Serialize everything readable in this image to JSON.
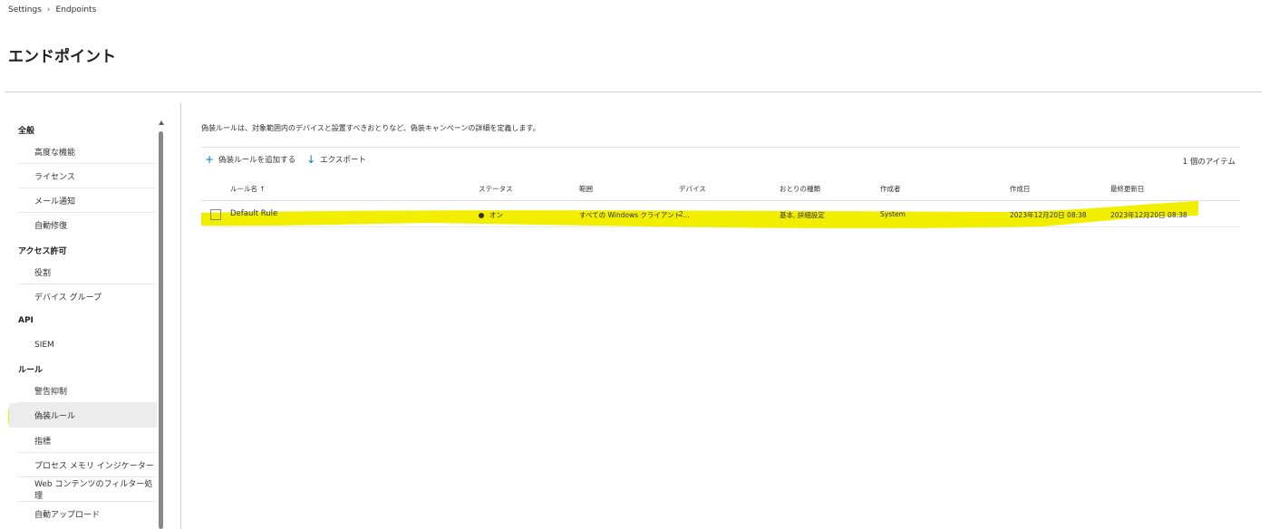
{
  "breadcrumb": {
    "parent": "Settings",
    "current": "Endpoints"
  },
  "page_title": "エンドポイント",
  "nav": {
    "groups": {
      "general": "全般",
      "permissions": "アクセス許可",
      "api": "API",
      "rules": "ルール"
    },
    "items": {
      "advanced": "高度な機能",
      "license": "ライセンス",
      "email": "メール通知",
      "auto_remediation": "自動修復",
      "roles": "役割",
      "device_groups": "デバイス グループ",
      "siem": "SIEM",
      "alert_suppression": "警告抑制",
      "deception_rules": "偽装ルール",
      "indicators": "指標",
      "process_memory": "プロセス メモリ インジケーター",
      "web_content": "Web コンテンツのフィルター処理",
      "auto_upload": "自動アップロード"
    }
  },
  "main": {
    "description": "偽装ルールは、対象範囲内のデバイスと設置すべきおとりなど、偽装キャンペーンの詳細を定義します。",
    "toolbar": {
      "add_label": "偽装ルールを追加する",
      "export_label": "エクスポート"
    },
    "item_count": "1 個のアイテム",
    "columns": {
      "rule_name": "ルール名 ↑",
      "status": "ステータス",
      "scope": "範囲",
      "devices": "デバイス",
      "lure_type": "おとりの種類",
      "creator": "作成者",
      "created": "作成日",
      "updated": "最終更新日"
    },
    "rows": [
      {
        "rule_name": "Default Rule",
        "status": "オン",
        "scope": "すべての Windows クライアント ...",
        "devices": "2",
        "lure_type": "基本, 詳細設定",
        "creator": "System",
        "created": "2023年12月20日 08:38",
        "updated": "2023年12月20日 08:38"
      }
    ]
  },
  "colors": {
    "highlight": "#f2ee00",
    "accent": "#0078d4"
  },
  "icons": {
    "breadcrumb_sep": "chevron-right-icon",
    "add": "plus-icon",
    "export": "download-arrow-icon"
  }
}
